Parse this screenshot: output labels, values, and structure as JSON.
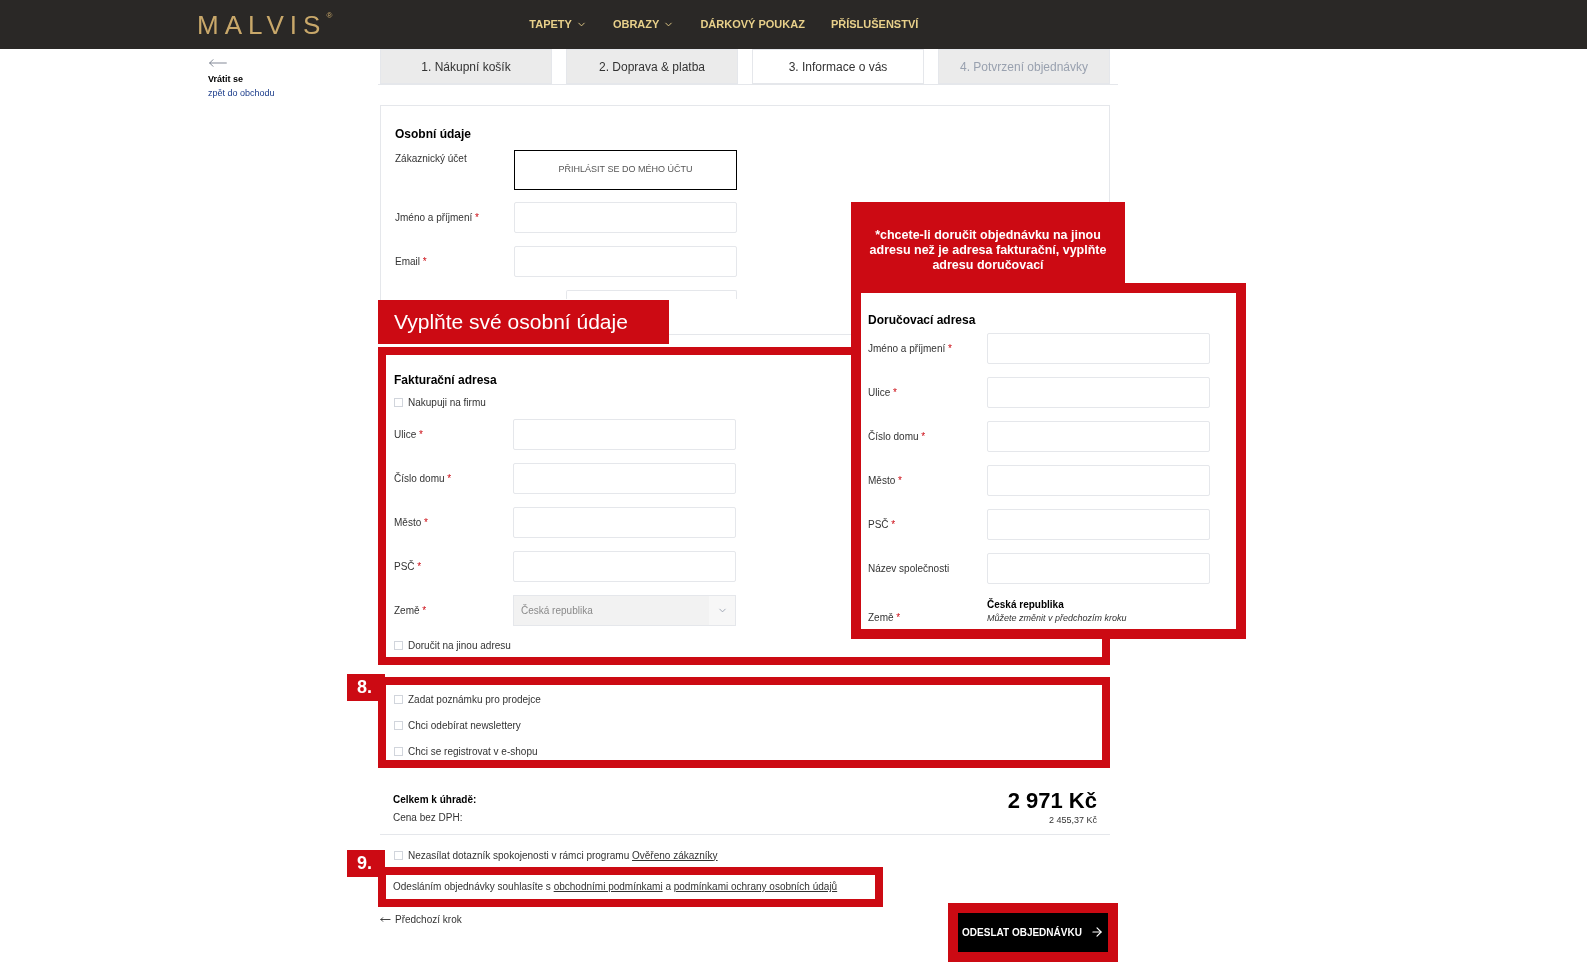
{
  "header": {
    "logo": {
      "text": "MALVIS",
      "mark": "®"
    },
    "nav": [
      {
        "label": "TAPETY",
        "dropdown": true
      },
      {
        "label": "OBRAZY",
        "dropdown": true
      },
      {
        "label": "DÁRKOVÝ POUKAZ",
        "dropdown": false
      },
      {
        "label": "PŘÍSLUŠENSTVÍ",
        "dropdown": false
      }
    ]
  },
  "back": {
    "title": "Vrátit se",
    "subtitle": "zpět do obchodu"
  },
  "steps": [
    {
      "label": "1. Nákupní košík",
      "selected": false,
      "disabled": false
    },
    {
      "label": "2. Doprava & platba",
      "selected": false,
      "disabled": false
    },
    {
      "label": "3. Informace o vás",
      "selected": true,
      "disabled": false
    },
    {
      "label": "4. Potvrzení objednávky",
      "selected": false,
      "disabled": true
    }
  ],
  "personal": {
    "title": "Osobní údaje",
    "account_label": "Zákaznický účet",
    "login_button": "PŘIHLÁSIT SE DO MÉHO ÚČTU",
    "fields": [
      {
        "label": "Jméno a příjmení",
        "mark": "*"
      },
      {
        "label": "Email",
        "mark": "*"
      }
    ]
  },
  "billing": {
    "banner": "Vyplňte své osobní údaje",
    "title": "Fakturační adresa",
    "company": {
      "label": "Nakupuji na firmu",
      "checked": false
    },
    "fields": [
      {
        "label": "Ulice",
        "mark": "*"
      },
      {
        "label": "Číslo domu",
        "mark": "*"
      },
      {
        "label": "Město",
        "mark": "*"
      },
      {
        "label": "PSČ",
        "mark": "*"
      }
    ],
    "country": {
      "label": "Země",
      "mark": "*",
      "value": "Česká republika",
      "disabled": true
    },
    "other_address": {
      "label": "Doručit na jinou adresu",
      "checked": false
    }
  },
  "delivery": {
    "note": "*chcete-li doručit objednávku na jinou adresu než je adresa fakturační, vyplňte adresu doručovací",
    "title": "Doručovací adresa",
    "fields": [
      {
        "label": "Jméno a příjmení",
        "mark": "*"
      },
      {
        "label": "Ulice",
        "mark": "*"
      },
      {
        "label": "Číslo domu",
        "mark": "*"
      },
      {
        "label": "Město",
        "mark": "*"
      },
      {
        "label": "PSČ",
        "mark": "*"
      },
      {
        "label": "Název společnosti"
      }
    ],
    "country": {
      "label": "Země",
      "mark": "*",
      "value": "Česká republika",
      "hint": "Můžete změnit v předchozím kroku"
    }
  },
  "extras": {
    "number": "8.",
    "options": [
      {
        "label": "Zadat poznámku pro prodejce",
        "checked": false
      },
      {
        "label": "Chci odebírat newslettery",
        "checked": false
      },
      {
        "label": "Chci se registrovat v e-shopu",
        "checked": false
      }
    ]
  },
  "totals": {
    "label": "Celkem k úhradě:",
    "amount": "2 971 Kč",
    "net_label": "Cena bez DPH:",
    "net_amount": "2 455,37 Kč"
  },
  "survey": {
    "label": "Nezasílat dotazník spokojenosti v rámci programu",
    "link": "Ověřeno zákazníky",
    "checked": false
  },
  "terms": {
    "number": "9.",
    "before": "Odesláním objednávky souhlasíte s",
    "link1": "obchodními podmínkami",
    "middle": "a",
    "link2": "podmínkami ochrany osobních údajů"
  },
  "prev_step": "Předchozí krok",
  "submit": "ODESLAT OBJEDNÁVKU"
}
